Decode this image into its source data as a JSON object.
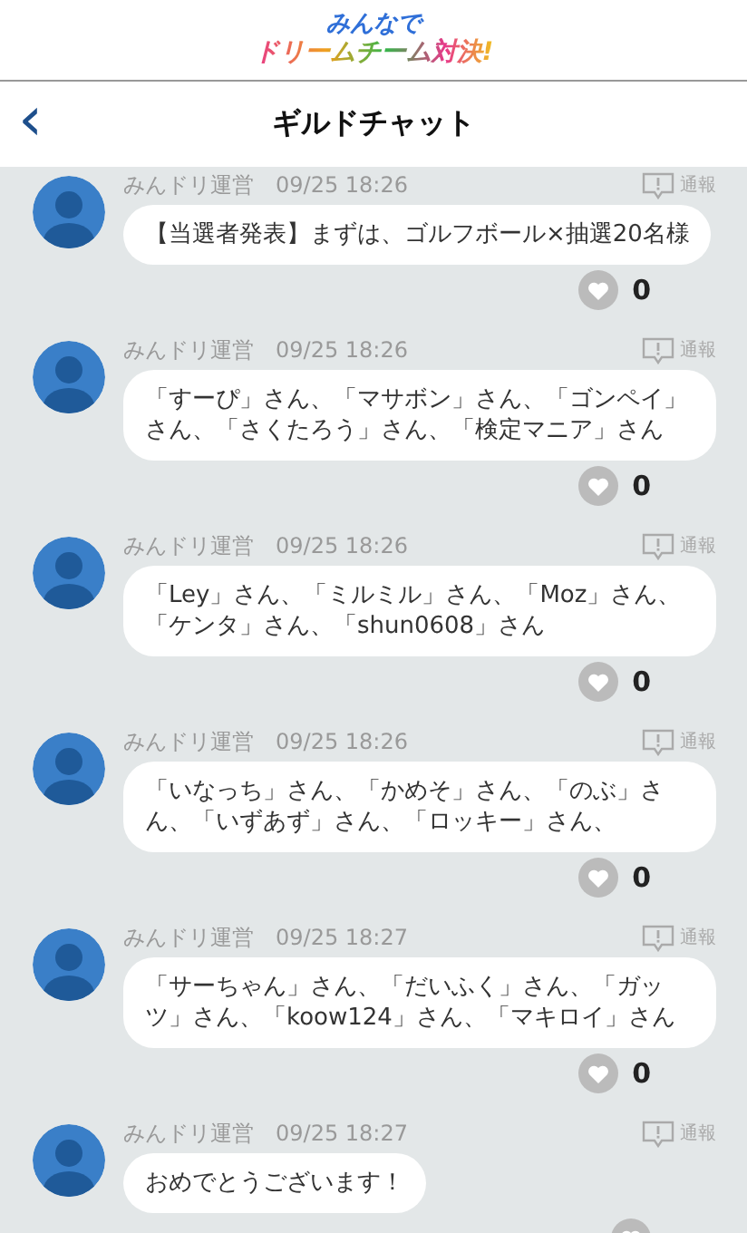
{
  "logo": {
    "line_1": "みんなで",
    "line_2": "ドリームチーム対決!"
  },
  "nav": {
    "back": "‹",
    "title": "ギルドチャット"
  },
  "messages": [
    {
      "author": "みんドリ運営",
      "time": "09/25 18:26",
      "report": "通報",
      "text": "【当選者発表】まずは、ゴルフボール×抽選20名様",
      "likes": "0"
    },
    {
      "author": "みんドリ運営",
      "time": "09/25 18:26",
      "report": "通報",
      "text": "「すーぴ」さん、「マサボン」さん、「ゴンペイ」さん、「さくたろう」さん、「検定マニア」さん",
      "likes": "0"
    },
    {
      "author": "みんドリ運営",
      "time": "09/25 18:26",
      "report": "通報",
      "text": "「Ley」さん、「ミルミル」さん、「Moz」さん、「ケンタ」さん、「shun0608」さん",
      "likes": "0"
    },
    {
      "author": "みんドリ運営",
      "time": "09/25 18:26",
      "report": "通報",
      "text": "「いなっち」さん、「かめそ」さん、「のぶ」さん、「いずあず」さん、「ロッキー」さん、",
      "likes": "0"
    },
    {
      "author": "みんドリ運営",
      "time": "09/25 18:27",
      "report": "通報",
      "text": "「サーちゃん」さん、「だいふく」さん、「ガッツ」さん、「koow124」さん、「マキロイ」さん",
      "likes": "0"
    },
    {
      "author": "みんドリ運営",
      "time": "09/25 18:27",
      "report": "通報",
      "text": "おめでとうございます！"
    }
  ]
}
